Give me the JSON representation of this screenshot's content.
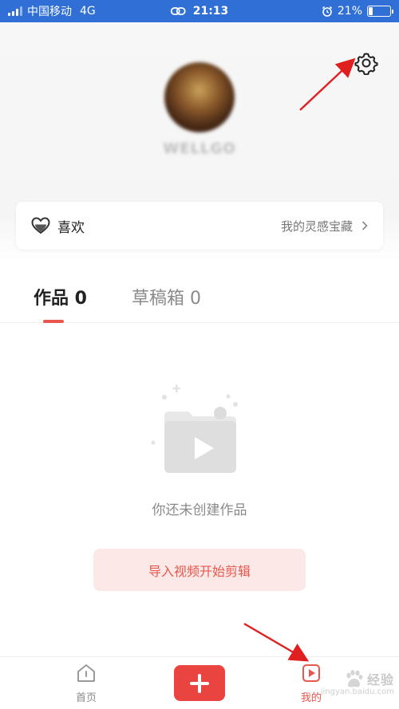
{
  "status": {
    "carrier": "中国移动",
    "network": "4G",
    "time": "21:13",
    "battery": "21%",
    "battery_level": 0.21
  },
  "profile": {
    "username": "WELLGO"
  },
  "likes": {
    "label": "喜欢",
    "link_text": "我的灵感宝藏"
  },
  "tabs": [
    {
      "label": "作品 0"
    },
    {
      "label": "草稿箱 0"
    }
  ],
  "empty": {
    "text": "你还未创建作品",
    "button": "导入视频开始剪辑"
  },
  "nav": {
    "home": "首页",
    "mine": "我的"
  },
  "watermark": {
    "text": "经验",
    "url": "jingyan.baidu.com"
  },
  "colors": {
    "accent": "#e8574e",
    "status_bar": "#2f6fd6",
    "create_button": "#ea4440",
    "annotation_arrow": "#e02020"
  }
}
